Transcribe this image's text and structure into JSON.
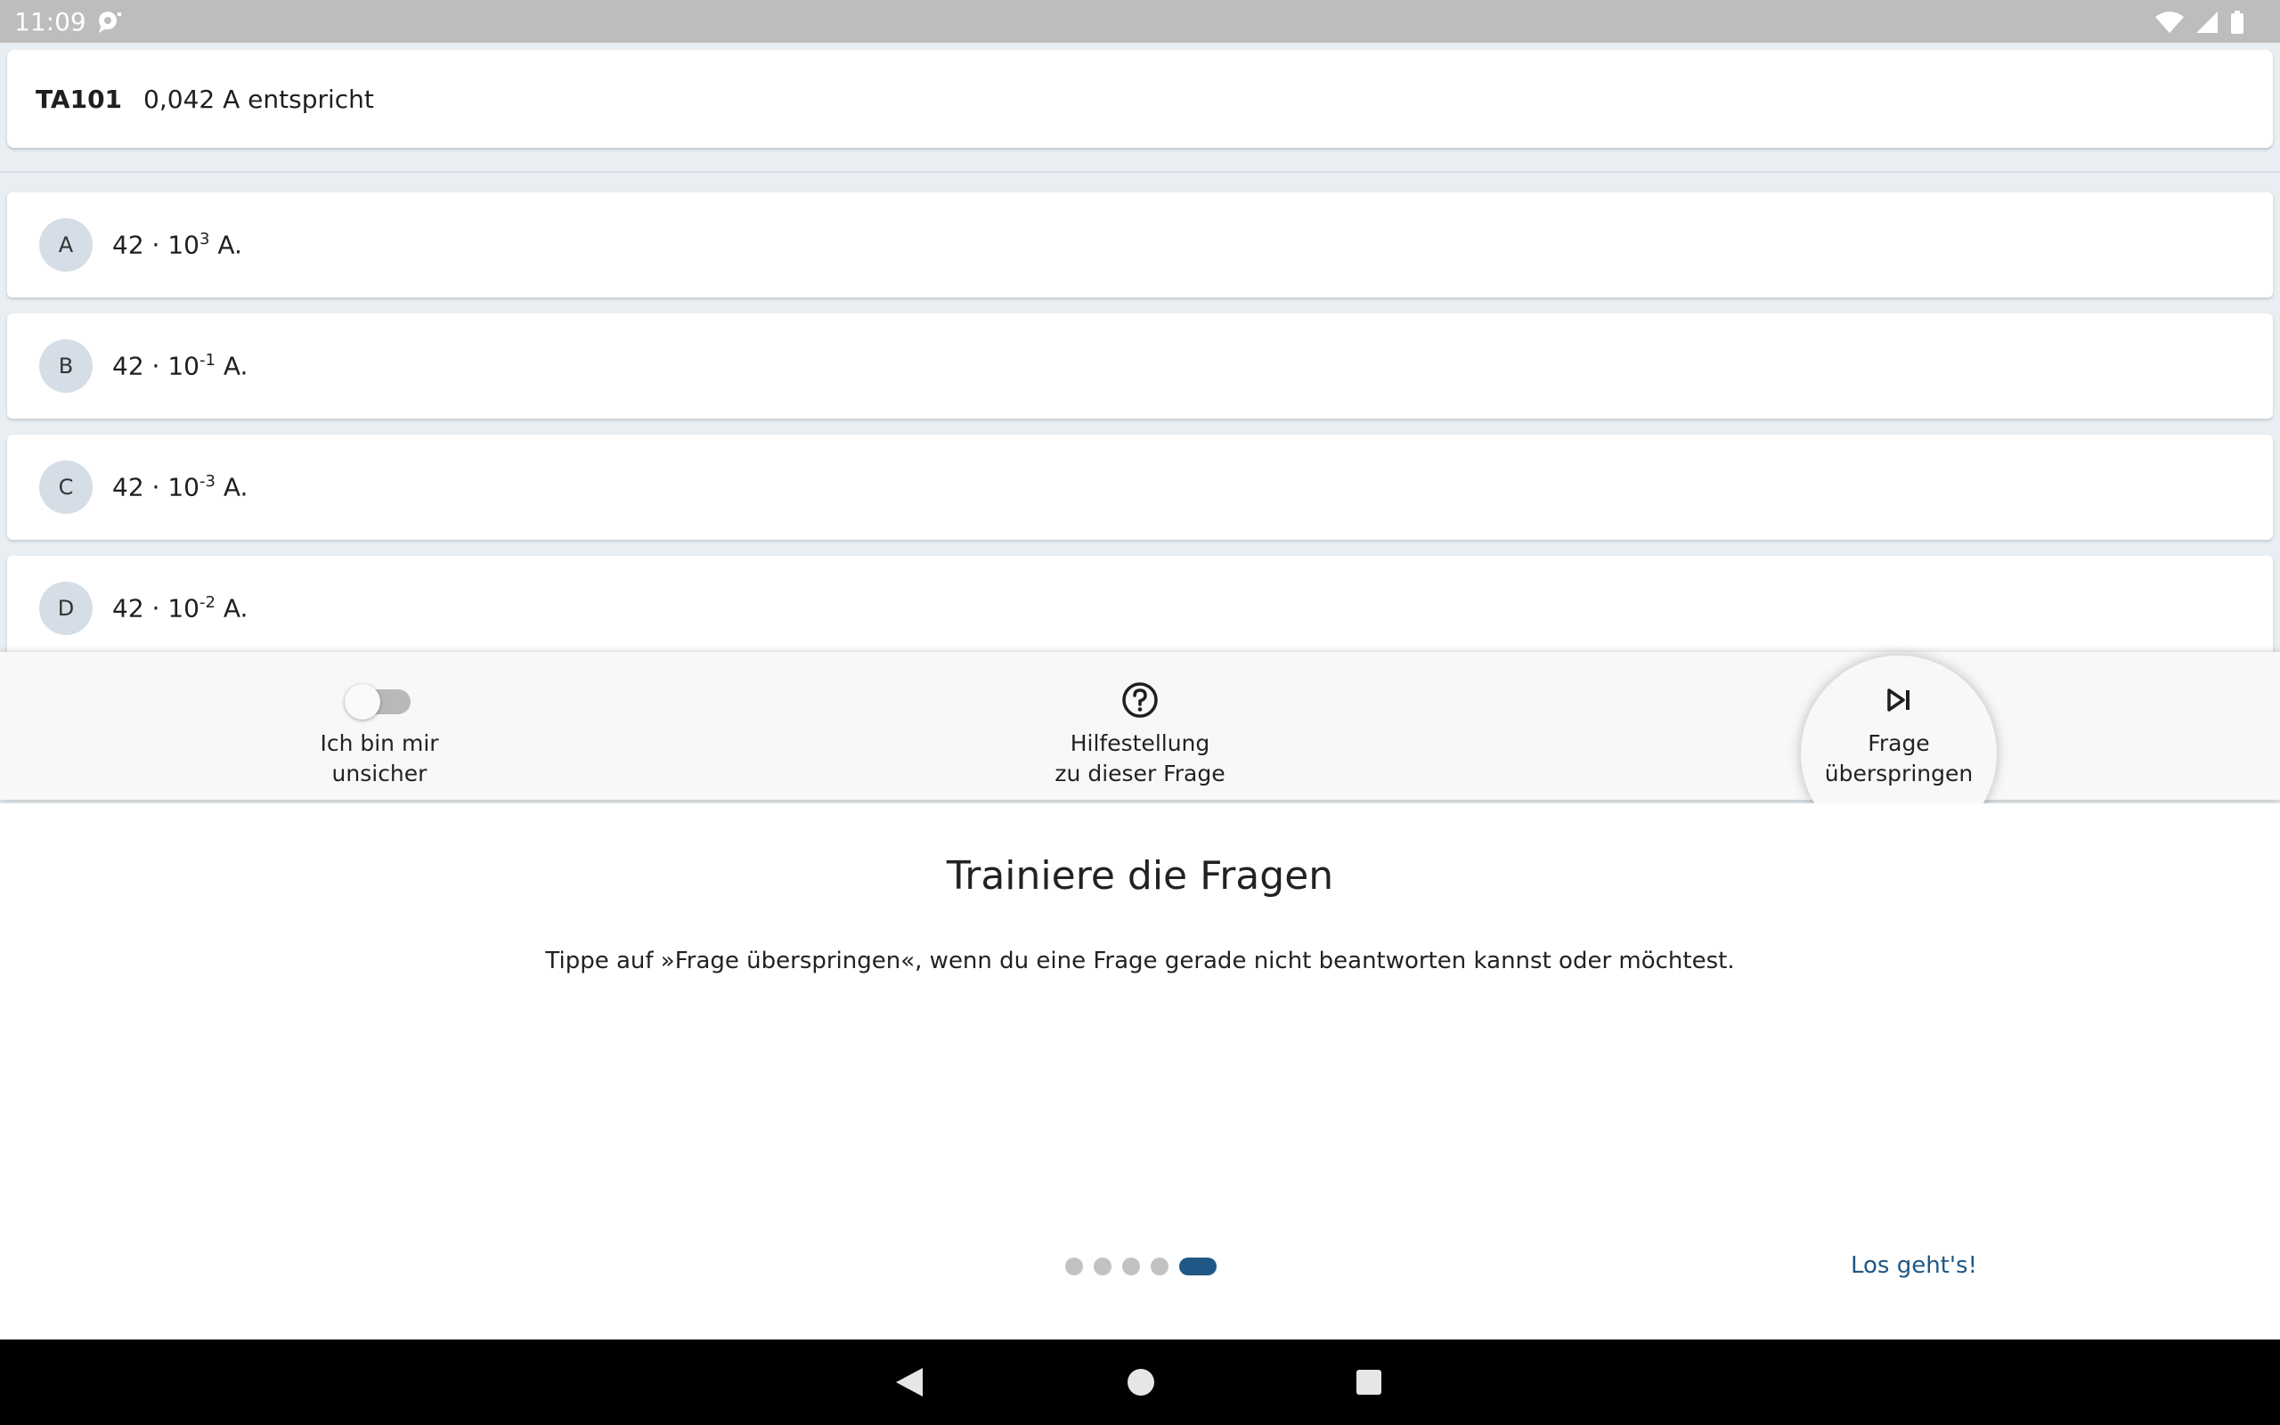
{
  "status_bar": {
    "time": "11:09",
    "icons": [
      "message-notification-icon",
      "wifi-icon",
      "cell-signal-icon",
      "battery-icon"
    ]
  },
  "question": {
    "id": "TA101",
    "text": "0,042 A entspricht"
  },
  "answers": [
    {
      "letter": "A",
      "base": "42 · 10",
      "exponent": "3",
      "unit": " A."
    },
    {
      "letter": "B",
      "base": "42 · 10",
      "exponent": "-1",
      "unit": " A."
    },
    {
      "letter": "C",
      "base": "42 · 10",
      "exponent": "-3",
      "unit": " A."
    },
    {
      "letter": "D",
      "base": "42 · 10",
      "exponent": "-2",
      "unit": " A."
    }
  ],
  "toolbar": {
    "unsure_label": "Ich bin mir\nunsicher",
    "unsure_on": false,
    "help_label": "Hilfestellung\nzu dieser Frage",
    "skip_label": "Frage\nüberspringen"
  },
  "onboarding": {
    "title": "Trainiere die Fragen",
    "description": "Tippe auf »Frage überspringen«, wenn du eine Frage gerade nicht beantworten kannst oder möchtest.",
    "page_count": 5,
    "active_page": 5,
    "cta": "Los geht's!"
  },
  "colors": {
    "accent": "#1f5786",
    "letter_badge": "#d5dde6",
    "status_bar": "#bdbdbd"
  }
}
